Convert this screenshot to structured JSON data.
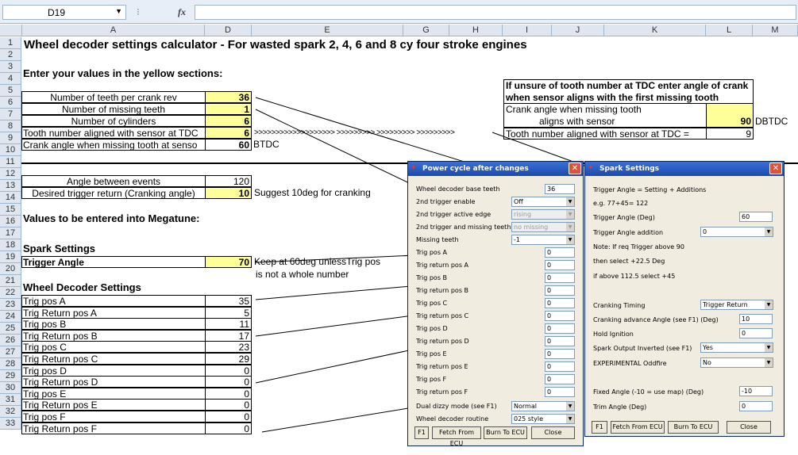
{
  "formula_bar": {
    "name_box": "D19",
    "fx": "fx"
  },
  "columns": [
    "A",
    "D",
    "E",
    "G",
    "H",
    "I",
    "J",
    "K",
    "L",
    "M"
  ],
  "rows": [
    "1",
    "2",
    "3",
    "4",
    "5",
    "6",
    "7",
    "8",
    "9",
    "10",
    "11",
    "12",
    "13",
    "14",
    "15",
    "16",
    "17",
    "18",
    "19",
    "20",
    "21",
    "22",
    "23",
    "24",
    "25",
    "26",
    "27",
    "28",
    "29",
    "30",
    "31",
    "32",
    "33"
  ],
  "sheet": {
    "title": "Wheel decoder settings calculator - For wasted spark 2, 4, 6 and 8 cy four stroke engines",
    "enter_values": "Enter your values in the yellow sections:",
    "inputs": [
      {
        "label": "Number of teeth per crank rev",
        "value": "36"
      },
      {
        "label": "Number of missing teeth",
        "value": "1"
      },
      {
        "label": "Number of cylinders",
        "value": "6"
      },
      {
        "label": "Tooth number aligned with sensor at TDC",
        "value": "6"
      },
      {
        "label": "Crank angle when missing tooth at senso",
        "value": "60"
      }
    ],
    "arrows_text": ">>>>>>>>>>>>>>>>>>> >>>>>>>>> >>>>>>>>> >>>>>>>>>",
    "btdc": "BTDC",
    "angle_between_label": "Angle between events",
    "angle_between_value": "120",
    "desired_trigger_label": "Desired trigger return (Cranking angle)",
    "desired_trigger_value": "10",
    "suggest": "Suggest 10deg for cranking",
    "values_megatune": "Values to be entered into Megatune:",
    "spark_settings": "Spark Settings",
    "trigger_angle_label": "Trigger Angle",
    "trigger_angle_value": "70",
    "keep_note_1": "Keep at 60deg unlessTrig pos",
    "keep_note_2": "is not a whole number",
    "wheel_decoder_settings": "Wheel Decoder Settings",
    "trig_rows": [
      {
        "label": "Trig pos A",
        "value": "35"
      },
      {
        "label": "Trig Return pos A",
        "value": "5"
      },
      {
        "label": "Trig pos B",
        "value": "11"
      },
      {
        "label": "Trig Return pos B",
        "value": "17"
      },
      {
        "label": "Trig pos C",
        "value": "23"
      },
      {
        "label": "Trig Return pos C",
        "value": "29"
      },
      {
        "label": "Trig pos D",
        "value": "0"
      },
      {
        "label": "Trig Return pos D",
        "value": "0"
      },
      {
        "label": "Trig pos E",
        "value": "0"
      },
      {
        "label": "Trig Return pos E",
        "value": "0"
      },
      {
        "label": "Trig pos F",
        "value": "0"
      },
      {
        "label": "Trig Return pos F",
        "value": "0"
      }
    ],
    "tdc_box": {
      "line1": "If unsure of tooth number at TDC enter angle of crank",
      "line2": "when sensor aligns with the first missing tooth",
      "crank_label_1": "Crank angle when missing tooth",
      "crank_label_2": "aligns with sensor",
      "crank_value": "90",
      "dbtdc": "DBTDC",
      "tooth_label": "Tooth number aligned with sensor at TDC =",
      "tooth_value": "9"
    }
  },
  "power_dialog": {
    "title": "Power cycle after changes",
    "fields": [
      {
        "label": "Wheel decoder base teeth",
        "value": "36",
        "kind": "input"
      },
      {
        "label": "2nd trigger enable",
        "value": "Off",
        "kind": "select"
      },
      {
        "label": "2nd trigger active edge",
        "value": "rising",
        "kind": "select-dis"
      },
      {
        "label": "2nd trigger and missing teeth",
        "value": "no missing",
        "kind": "select-dis"
      },
      {
        "label": "Missing teeth",
        "value": "-1",
        "kind": "select"
      },
      {
        "label": "Trig pos A",
        "value": "0",
        "kind": "input"
      },
      {
        "label": "Trig return pos A",
        "value": "0",
        "kind": "input"
      },
      {
        "label": "Trig pos B",
        "value": "0",
        "kind": "input"
      },
      {
        "label": "Trig return pos B",
        "value": "0",
        "kind": "input"
      },
      {
        "label": "Trig pos C",
        "value": "0",
        "kind": "input"
      },
      {
        "label": "Trig return pos C",
        "value": "0",
        "kind": "input"
      },
      {
        "label": "Trig pos D",
        "value": "0",
        "kind": "input"
      },
      {
        "label": "Trig return pos D",
        "value": "0",
        "kind": "input"
      },
      {
        "label": "Trig pos E",
        "value": "0",
        "kind": "input"
      },
      {
        "label": "Trig return pos E",
        "value": "0",
        "kind": "input"
      },
      {
        "label": "Trig pos F",
        "value": "0",
        "kind": "input"
      },
      {
        "label": "Trig return pos F",
        "value": "0",
        "kind": "input"
      },
      {
        "label": "Dual dizzy mode (see F1)",
        "value": "Normal",
        "kind": "select"
      },
      {
        "label": "Wheel decoder routine",
        "value": "025 style",
        "kind": "select"
      }
    ],
    "buttons": [
      "F1",
      "Fetch From ECU",
      "Burn To ECU",
      "Close"
    ]
  },
  "spark_dialog": {
    "title": "Spark Settings",
    "note1": "Trigger Angle = Setting + Additions",
    "note2": "e.g. 77+45= 122",
    "trigger_angle_label": "Trigger Angle  (Deg)",
    "trigger_angle_value": "60",
    "trigger_add_label": "Trigger Angle addition",
    "trigger_add_value": "0",
    "note3": "Note: If req Trigger above 90",
    "note4": "then select +22.5 Deg",
    "note5": "if above 112.5 select +45",
    "cranking_timing_label": "Cranking Timing",
    "cranking_timing_value": "Trigger Return",
    "cranking_advance_label": "Cranking advance Angle (see F1) (Deg)",
    "cranking_advance_value": "10",
    "hold_ignition_label": "Hold Ignition",
    "hold_ignition_value": "0",
    "spark_inverted_label": "Spark Output Inverted (see F1)",
    "spark_inverted_value": "Yes",
    "oddfire_label": "EXPERIMENTAL Oddfire",
    "oddfire_value": "No",
    "fixed_angle_label": "Fixed Angle (-10 = use map) (Deg)",
    "fixed_angle_value": "-10",
    "trim_angle_label": "Trim Angle (Deg)",
    "trim_angle_value": "0",
    "buttons": [
      "F1",
      "Fetch From ECU",
      "Burn To ECU",
      "Close"
    ]
  }
}
